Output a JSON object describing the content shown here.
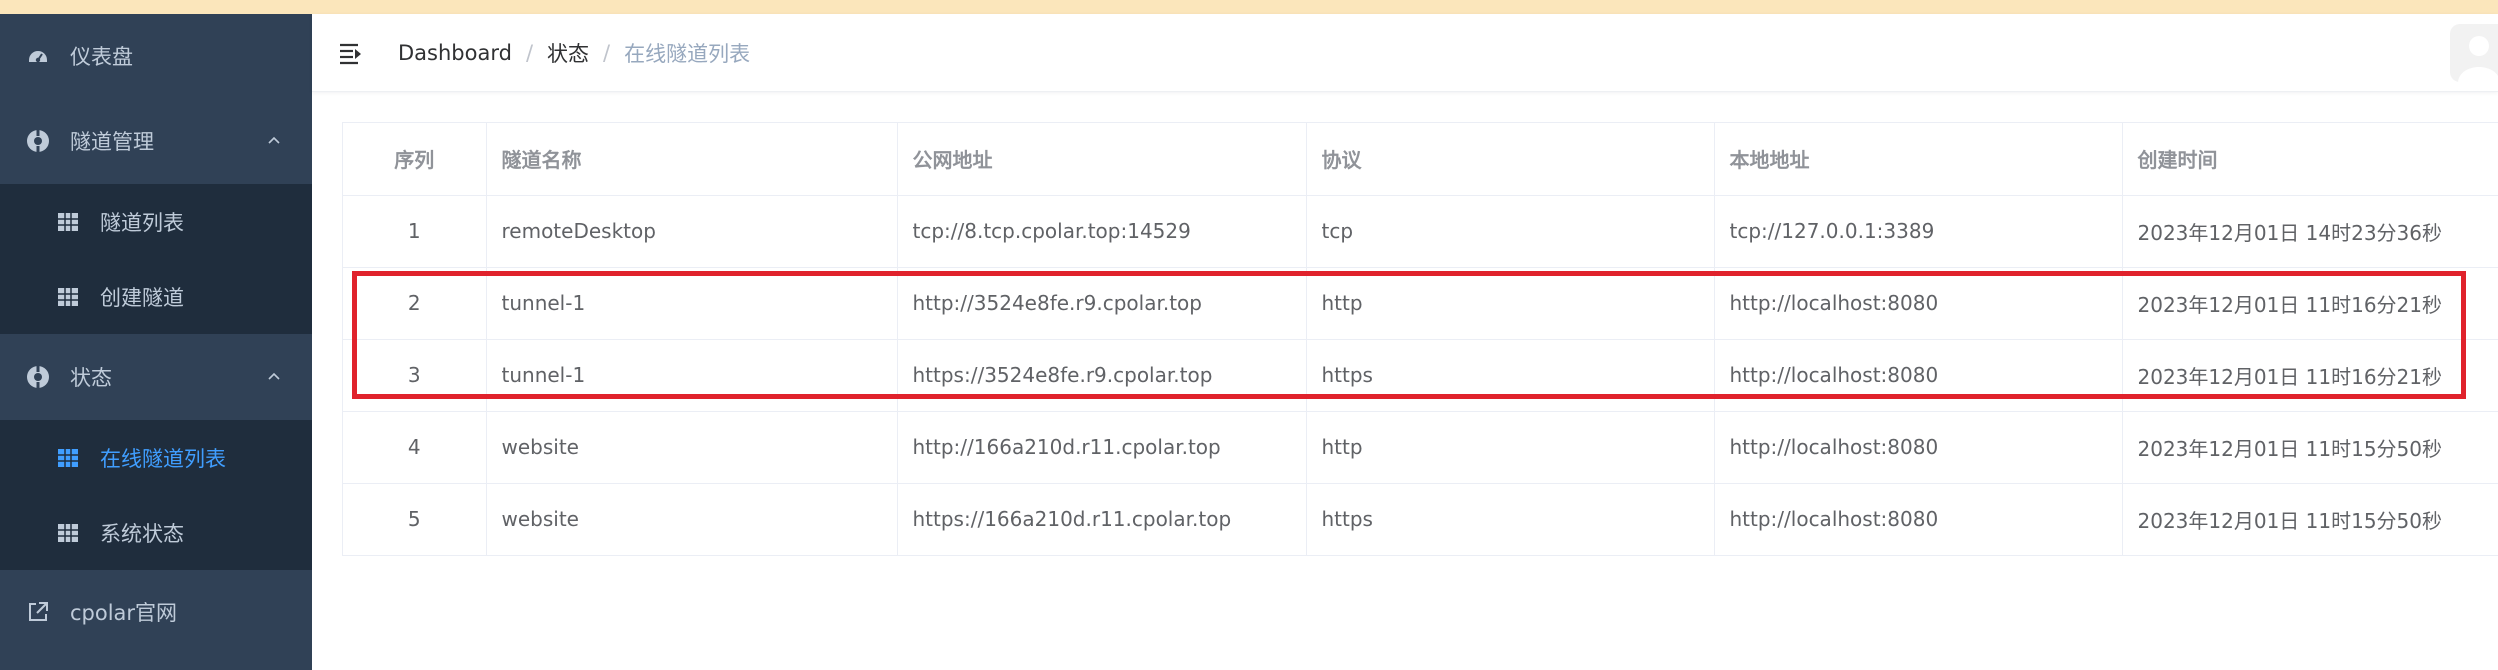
{
  "sidebar": {
    "items": [
      {
        "label": "仪表盘",
        "icon": "dashboard-icon"
      },
      {
        "label": "隧道管理",
        "icon": "tunnel-management-icon",
        "expanded": true,
        "children": [
          {
            "label": "隧道列表",
            "icon": "table-grid-icon"
          },
          {
            "label": "创建隧道",
            "icon": "table-grid-icon"
          }
        ]
      },
      {
        "label": "状态",
        "icon": "status-icon",
        "expanded": true,
        "children": [
          {
            "label": "在线隧道列表",
            "icon": "table-grid-icon",
            "active": true
          },
          {
            "label": "系统状态",
            "icon": "table-grid-icon"
          }
        ]
      },
      {
        "label": "cpolar官网",
        "icon": "external-link-icon"
      }
    ]
  },
  "breadcrumb": [
    "Dashboard",
    "状态",
    "在线隧道列表"
  ],
  "table": {
    "headers": [
      "序列",
      "隧道名称",
      "公网地址",
      "协议",
      "本地地址",
      "创建时间"
    ],
    "rows": [
      [
        "1",
        "remoteDesktop",
        "tcp://8.tcp.cpolar.top:14529",
        "tcp",
        "tcp://127.0.0.1:3389",
        "2023年12月01日 14时23分36秒"
      ],
      [
        "2",
        "tunnel-1",
        "http://3524e8fe.r9.cpolar.top",
        "http",
        "http://localhost:8080",
        "2023年12月01日 11时16分21秒"
      ],
      [
        "3",
        "tunnel-1",
        "https://3524e8fe.r9.cpolar.top",
        "https",
        "http://localhost:8080",
        "2023年12月01日 11时16分21秒"
      ],
      [
        "4",
        "website",
        "http://166a210d.r11.cpolar.top",
        "http",
        "http://localhost:8080",
        "2023年12月01日 11时15分50秒"
      ],
      [
        "5",
        "website",
        "https://166a210d.r11.cpolar.top",
        "https",
        "http://localhost:8080",
        "2023年12月01日 11时15分50秒"
      ]
    ]
  },
  "colors": {
    "sidebar_bg": "#304156",
    "submenu_bg": "#1f2d3d",
    "active": "#409eff",
    "highlight_border": "#e0222c",
    "top_strip": "#fbe6bb"
  }
}
